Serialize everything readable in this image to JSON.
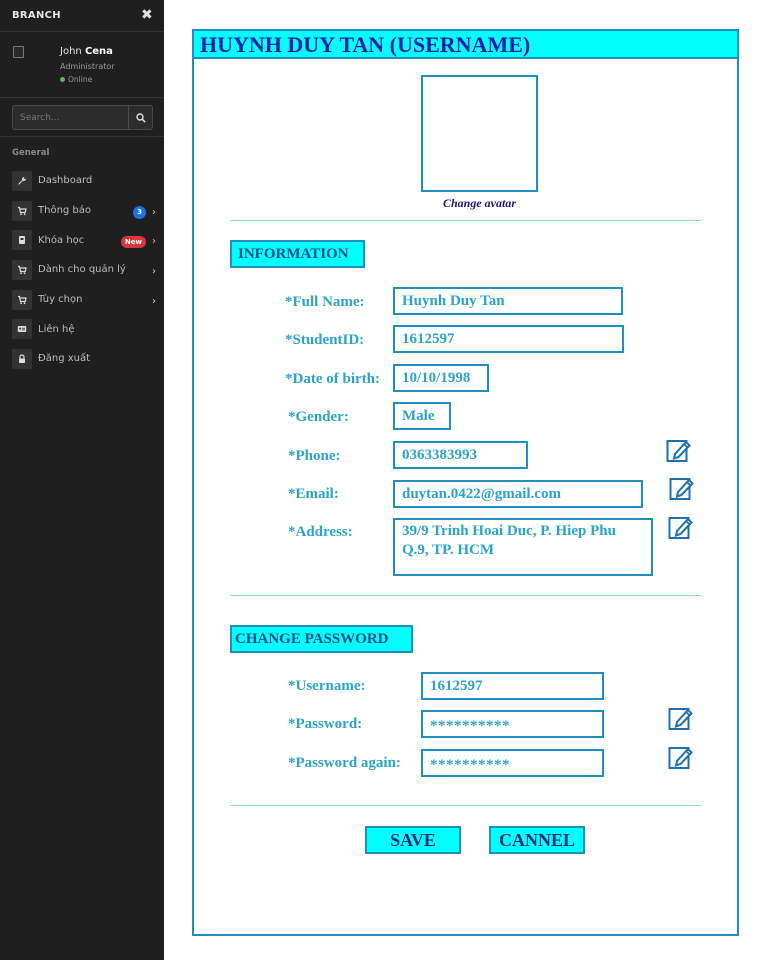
{
  "sidebar": {
    "brand": "BRANCH",
    "close_icon": "close-icon",
    "user": {
      "first_name": "John",
      "last_name": "Cena",
      "role": "Administrator",
      "status": "Online",
      "status_color": "#5cb85c"
    },
    "search": {
      "placeholder": "Search...",
      "icon": "search-icon"
    },
    "section_label": "General",
    "items": [
      {
        "label": "Dashboard",
        "icon": "wrench-icon"
      },
      {
        "label": "Thông báo",
        "icon": "cart-icon",
        "badge": "3",
        "badge_color": "#1a73e8",
        "chevron": true
      },
      {
        "label": "Khóa học",
        "icon": "book-icon",
        "badge": "New",
        "badge_color": "#d9363e",
        "chevron": true
      },
      {
        "label": "Dành cho quản lý",
        "icon": "cart-icon",
        "chevron": true
      },
      {
        "label": "Tùy chọn",
        "icon": "cart-icon",
        "chevron": true
      },
      {
        "label": "Liên hệ",
        "icon": "id-card-icon"
      },
      {
        "label": "Đăng xuất",
        "icon": "lock-icon"
      }
    ]
  },
  "main": {
    "title": "HUYNH DUY TAN (USERNAME)",
    "change_avatar": "Change avatar",
    "information": {
      "header": "INFORMATION",
      "full_name_label": "*Full Name:",
      "full_name": "Huynh Duy Tan",
      "student_id_label": "*StudentID:",
      "student_id": "1612597",
      "dob_label": "*Date of birth:",
      "dob": "10/10/1998",
      "gender_label": "*Gender:",
      "gender": "Male",
      "phone_label": "*Phone:",
      "phone": "0363383993",
      "email_label": "*Email:",
      "email": "duytan.0422@gmail.com",
      "address_label": "*Address:",
      "address": "39/9 Trinh Hoai Duc, P. Hiep Phu Q.9, TP. HCM"
    },
    "change_password": {
      "header": "CHANGE PASSWORD",
      "username_label": "*Username:",
      "username": "1612597",
      "password_label": "*Password:",
      "password": "**********",
      "password_again_label": "*Password again:",
      "password_again": "**********"
    },
    "save_label": "SAVE",
    "cancel_label": "CANNEL"
  },
  "colors": {
    "accent_cyan": "#00ffff",
    "border_blue": "#1e8fbf",
    "label_blue": "#2aa4c9",
    "title_blue": "#0a1fa8",
    "sidebar_bg": "#1f1f1f"
  }
}
